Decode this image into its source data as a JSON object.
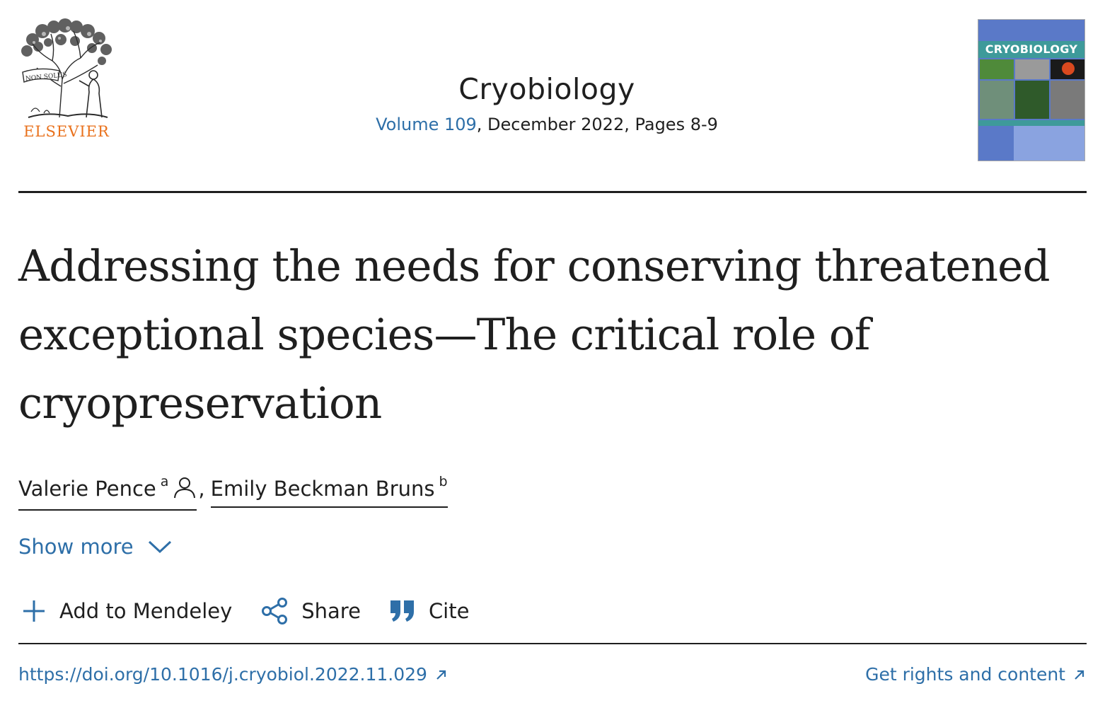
{
  "publisher": {
    "logo_text": "ELSEVIER",
    "logo_motto": "NON SOLUS",
    "accent_color": "#e9711c"
  },
  "journal": {
    "title": "Cryobiology",
    "volume_link": "Volume 109",
    "meta_rest": ", December 2022, Pages 8-9",
    "cover_title": "CRYOBIOLOGY"
  },
  "article": {
    "title": "Addressing the needs for conserving threatened exceptional species—The critical role of cryopreservation"
  },
  "authors": [
    {
      "name": "Valerie Pence",
      "affiliation": "a",
      "icon": "person-icon"
    },
    {
      "name": "Emily Beckman Bruns",
      "affiliation": "b"
    }
  ],
  "author_separator": ",",
  "show_more": {
    "label": "Show more",
    "icon": "chevron-down-icon"
  },
  "actions": {
    "mendeley": {
      "label": "Add to Mendeley",
      "icon": "plus-icon"
    },
    "share": {
      "label": "Share",
      "icon": "share-icon"
    },
    "cite": {
      "label": "Cite",
      "icon": "quote-icon"
    }
  },
  "links": {
    "doi": "https://doi.org/10.1016/j.cryobiol.2022.11.029",
    "rights": "Get rights and content",
    "icon": "external-link-icon"
  },
  "colors": {
    "link": "#2e6fa8",
    "text": "#1f1f1f"
  }
}
